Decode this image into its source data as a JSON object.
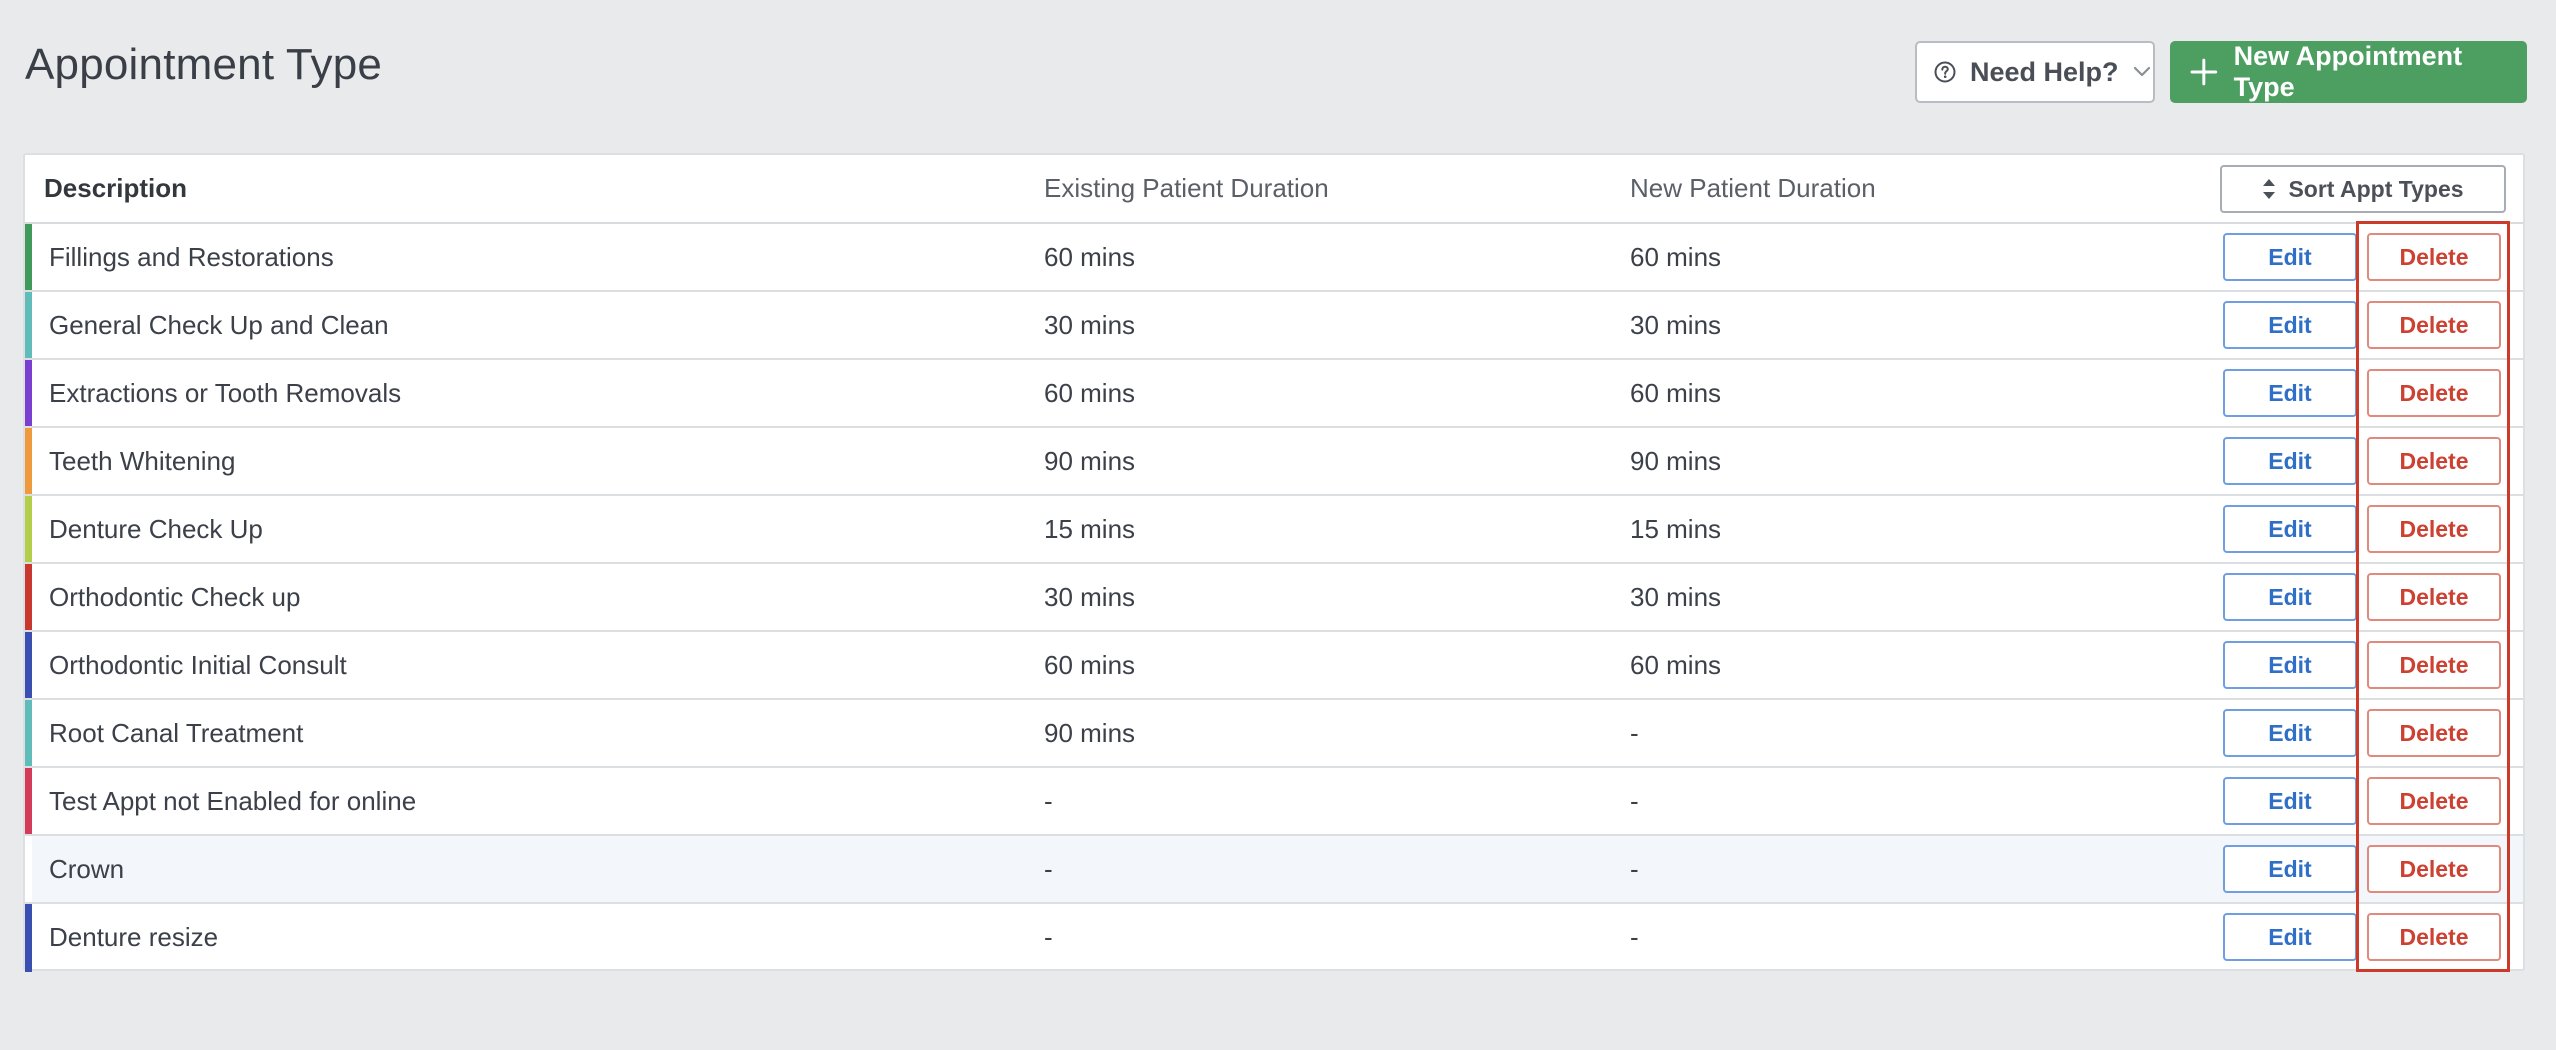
{
  "page": {
    "title": "Appointment Type"
  },
  "header": {
    "help_label": "Need Help?",
    "help_icon": "question-circle-icon",
    "help_chevron_icon": "chevron-down-icon",
    "new_label": "New Appointment Type",
    "new_icon": "plus-icon"
  },
  "table": {
    "columns": {
      "description": "Description",
      "existing": "Existing Patient Duration",
      "new": "New Patient Duration"
    },
    "sort_label": "Sort Appt Types",
    "sort_icon": "sort-icon",
    "edit_label": "Edit",
    "delete_label": "Delete",
    "rows": [
      {
        "description": "Fillings and Restorations",
        "existing": "60 mins",
        "new": "60 mins",
        "color": "#3f9a5c"
      },
      {
        "description": "General Check Up and Clean",
        "existing": "30 mins",
        "new": "30 mins",
        "color": "#5fbcb9"
      },
      {
        "description": "Extractions or Tooth Removals",
        "existing": "60 mins",
        "new": "60 mins",
        "color": "#7a3ed0"
      },
      {
        "description": "Teeth Whitening",
        "existing": "90 mins",
        "new": "90 mins",
        "color": "#f09a3e"
      },
      {
        "description": "Denture Check Up",
        "existing": "15 mins",
        "new": "15 mins",
        "color": "#b3cf4a"
      },
      {
        "description": "Orthodontic Check up",
        "existing": "30 mins",
        "new": "30 mins",
        "color": "#c8382f"
      },
      {
        "description": "Orthodontic Initial Consult",
        "existing": "60 mins",
        "new": "60 mins",
        "color": "#3b4fb0"
      },
      {
        "description": "Root Canal Treatment",
        "existing": "90 mins",
        "new": "-",
        "color": "#5fbcb9"
      },
      {
        "description": "Test Appt not Enabled for online",
        "existing": "-",
        "new": "-",
        "color": "#d43a5a"
      },
      {
        "description": "Crown",
        "existing": "-",
        "new": "-",
        "color": "#ffffff"
      },
      {
        "description": "Denture resize",
        "existing": "-",
        "new": "-",
        "color": "#3b4fb0"
      }
    ]
  },
  "colors": {
    "background": "#e9eaec",
    "primary_green": "#4c9f60",
    "edit_blue": "#2f6fc7",
    "delete_red": "#cc4131",
    "highlight_red": "#cc3b2a"
  }
}
